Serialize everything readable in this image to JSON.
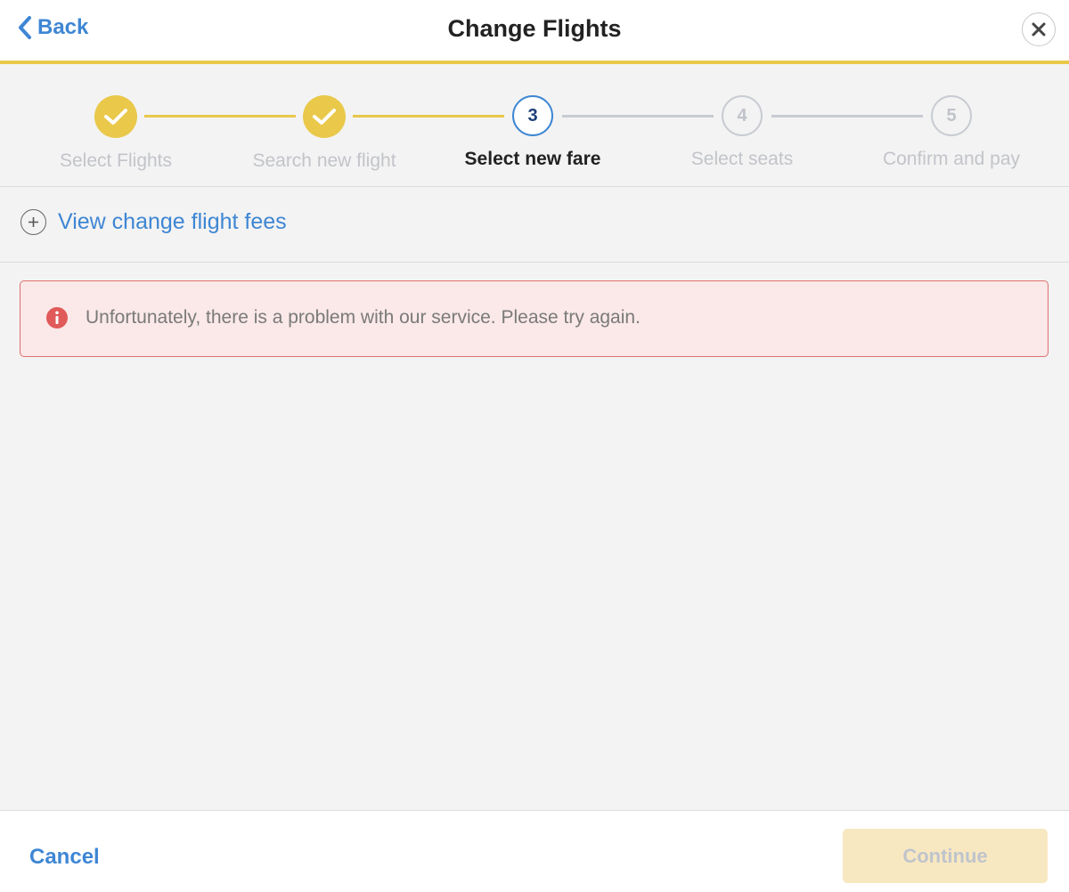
{
  "header": {
    "back_label": "Back",
    "title": "Change Flights",
    "close_icon": "close-icon"
  },
  "stepper": {
    "current_step": 3,
    "steps": [
      {
        "number": "1",
        "label": "Select Flights",
        "status": "done"
      },
      {
        "number": "2",
        "label": "Search new flight",
        "status": "done"
      },
      {
        "number": "3",
        "label": "Select new fare",
        "status": "current"
      },
      {
        "number": "4",
        "label": "Select seats",
        "status": "todo"
      },
      {
        "number": "5",
        "label": "Confirm and pay",
        "status": "todo"
      }
    ]
  },
  "fees": {
    "label": "View change flight fees",
    "icon": "plus-circle-icon"
  },
  "error": {
    "icon": "error-info-icon",
    "message": "Unfortunately, there is a problem with our service. Please try again."
  },
  "footer": {
    "cancel_label": "Cancel",
    "continue_label": "Continue",
    "continue_disabled": true
  },
  "colors": {
    "accent_blue": "#3e86d4",
    "progress_yellow": "#e9c84a",
    "error_red": "#e05a5a",
    "error_bg": "#fbe8e8"
  }
}
